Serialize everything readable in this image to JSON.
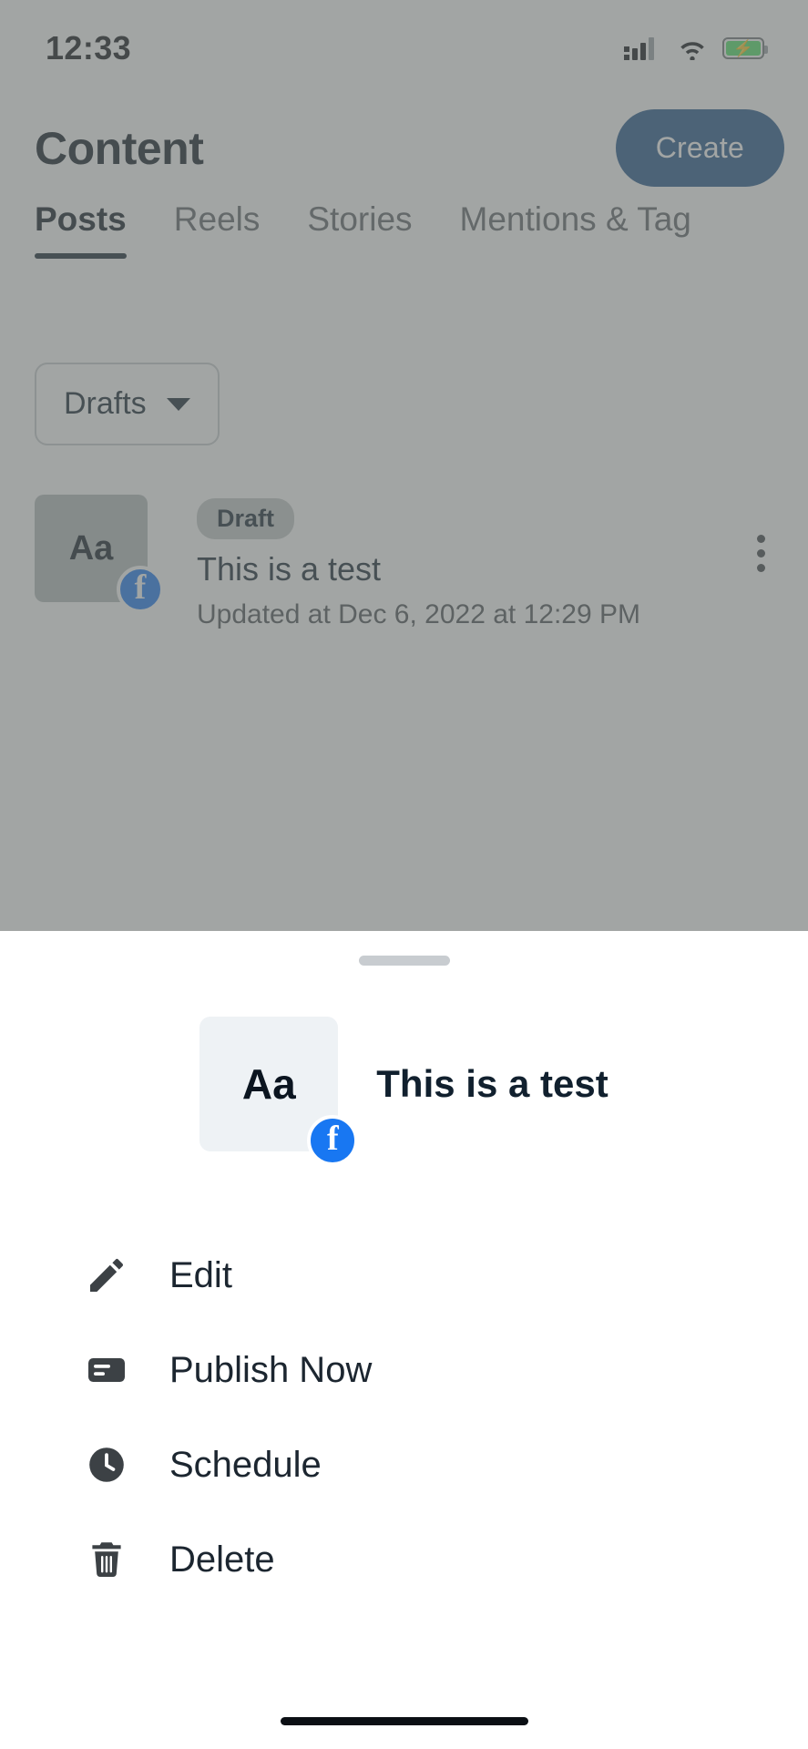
{
  "status_bar": {
    "time": "12:33",
    "icons": [
      "cellular-signal-icon",
      "wifi-icon",
      "battery-charging-icon"
    ]
  },
  "header": {
    "title": "Content",
    "create_label": "Create"
  },
  "tabs": [
    {
      "label": "Posts",
      "active": true
    },
    {
      "label": "Reels",
      "active": false
    },
    {
      "label": "Stories",
      "active": false
    },
    {
      "label": "Mentions & Tag",
      "active": false
    }
  ],
  "filter": {
    "label": "Drafts",
    "icon": "chevron-down-icon"
  },
  "post": {
    "thumb_text": "Aa",
    "platform_icon": "facebook-icon",
    "badge": "Draft",
    "title": "This is a test",
    "subtitle": "Updated at Dec 6, 2022 at 12:29 PM",
    "overflow_icon": "kebab-menu-icon"
  },
  "sheet": {
    "thumb_text": "Aa",
    "platform_icon": "facebook-icon",
    "title": "This is a test",
    "menu": [
      {
        "label": "Edit",
        "icon": "pencil-icon"
      },
      {
        "label": "Publish Now",
        "icon": "publish-card-icon"
      },
      {
        "label": "Schedule",
        "icon": "clock-icon"
      },
      {
        "label": "Delete",
        "icon": "trash-icon"
      }
    ]
  },
  "colors": {
    "accent": "#1f5288",
    "facebook": "#1877f2",
    "text": "#11202e",
    "battery": "#4ce364"
  }
}
